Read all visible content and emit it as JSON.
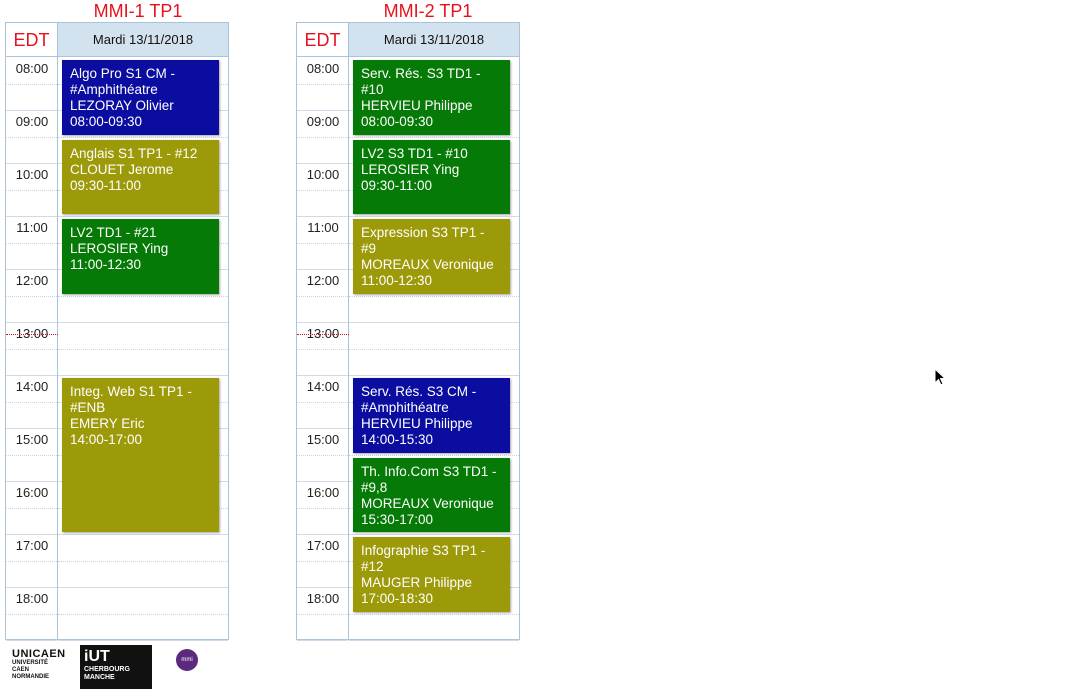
{
  "groups": [
    {
      "title": "MMI-1 TP1",
      "edt_label": "EDT",
      "day": "Mardi 13/11/2018",
      "hours": [
        "08:00",
        "09:00",
        "10:00",
        "11:00",
        "12:00",
        "13:00",
        "14:00",
        "15:00",
        "16:00",
        "17:00",
        "18:00"
      ],
      "events": [
        {
          "lines": [
            "Algo Pro S1 CM -",
            "#Amphithéatre",
            "LEZORAY Olivier",
            "08:00-09:30"
          ],
          "start": 8.0,
          "end": 9.5,
          "color": "#0b0ca0"
        },
        {
          "lines": [
            "Anglais S1 TP1 - #12",
            "CLOUET Jerome",
            "09:30-11:00"
          ],
          "start": 9.5,
          "end": 11.0,
          "color": "#9d9a0a"
        },
        {
          "lines": [
            "LV2 TD1 - #21",
            "LEROSIER Ying",
            "11:00-12:30"
          ],
          "start": 11.0,
          "end": 12.5,
          "color": "#067a06"
        },
        {
          "lines": [
            "Integ. Web S1 TP1 -",
            "#ENB",
            "EMERY Eric",
            "14:00-17:00"
          ],
          "start": 14.0,
          "end": 17.0,
          "color": "#9d9a0a"
        }
      ]
    },
    {
      "title": "MMI-2 TP1",
      "edt_label": "EDT",
      "day": "Mardi 13/11/2018",
      "hours": [
        "08:00",
        "09:00",
        "10:00",
        "11:00",
        "12:00",
        "13:00",
        "14:00",
        "15:00",
        "16:00",
        "17:00",
        "18:00"
      ],
      "events": [
        {
          "lines": [
            "Serv. Rés. S3 TD1 -",
            "#10",
            "HERVIEU Philippe",
            "08:00-09:30"
          ],
          "start": 8.0,
          "end": 9.5,
          "color": "#067a06"
        },
        {
          "lines": [
            "LV2 S3 TD1 - #10",
            "LEROSIER Ying",
            "09:30-11:00"
          ],
          "start": 9.5,
          "end": 11.0,
          "color": "#067a06"
        },
        {
          "lines": [
            "Expression S3 TP1 -",
            "#9",
            "MOREAUX Veronique",
            "11:00-12:30"
          ],
          "start": 11.0,
          "end": 12.5,
          "color": "#9d9a0a"
        },
        {
          "lines": [
            "Serv. Rés. S3 CM -",
            "#Amphithéatre",
            "HERVIEU Philippe",
            "14:00-15:30"
          ],
          "start": 14.0,
          "end": 15.5,
          "color": "#0b0ca0"
        },
        {
          "lines": [
            "Th. Info.Com S3 TD1 -",
            "#9,8",
            "MOREAUX Veronique",
            "15:30-17:00"
          ],
          "start": 15.5,
          "end": 17.0,
          "color": "#067a06"
        },
        {
          "lines": [
            "Infographie S3 TP1 -",
            "#12",
            "MAUGER Philippe",
            "17:00-18:30"
          ],
          "start": 17.0,
          "end": 18.5,
          "color": "#9d9a0a"
        }
      ]
    }
  ],
  "lunch_hour": "13:00",
  "logos": {
    "ucaen": [
      "UNICAEN",
      "UNIVERSITÉ",
      "CAEN",
      "NORMANDIE"
    ],
    "iut": [
      "iUT",
      "CHERBOURG",
      "MANCHE"
    ],
    "mmi": "mmi"
  }
}
